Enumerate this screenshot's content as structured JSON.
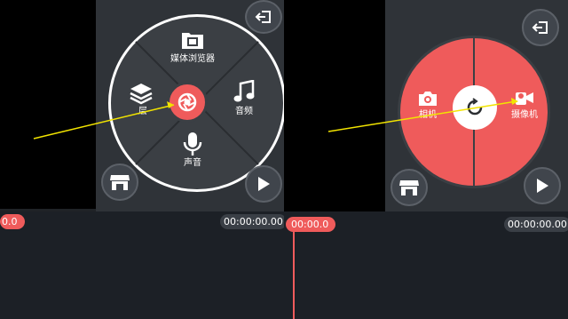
{
  "left": {
    "menu": {
      "media_browser_label": "媒体浏览器",
      "layer_label": "层",
      "audio_label": "音频",
      "voice_label": "声音"
    },
    "timeline": {
      "playhead_time": "0.0",
      "current_time": "00:00:00.00"
    }
  },
  "right": {
    "capture_menu": {
      "camera_label": "相机",
      "camcorder_label": "摄像机"
    },
    "timeline": {
      "playhead_time": "00:00.0",
      "current_time": "00:00:00.00"
    }
  },
  "colors": {
    "accent": "#ef5b5b",
    "wheel_dark": "#3b3f44",
    "annotation_arrow": "#f2e400"
  }
}
